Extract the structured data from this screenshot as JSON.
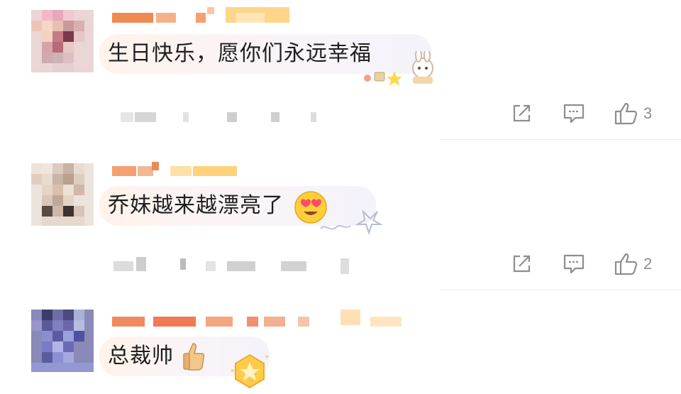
{
  "comments": [
    {
      "text": "生日快乐，愿你们永远幸福",
      "likes": "3"
    },
    {
      "text": "乔妹越来越漂亮了",
      "likes": "2"
    },
    {
      "text": "总裁帅"
    }
  ],
  "icons": {
    "share": "share-icon",
    "comment": "comment-icon",
    "like": "thumbs-up-icon"
  },
  "colors": {
    "accent": "#e8712a",
    "icon": "#8e8e8e"
  }
}
